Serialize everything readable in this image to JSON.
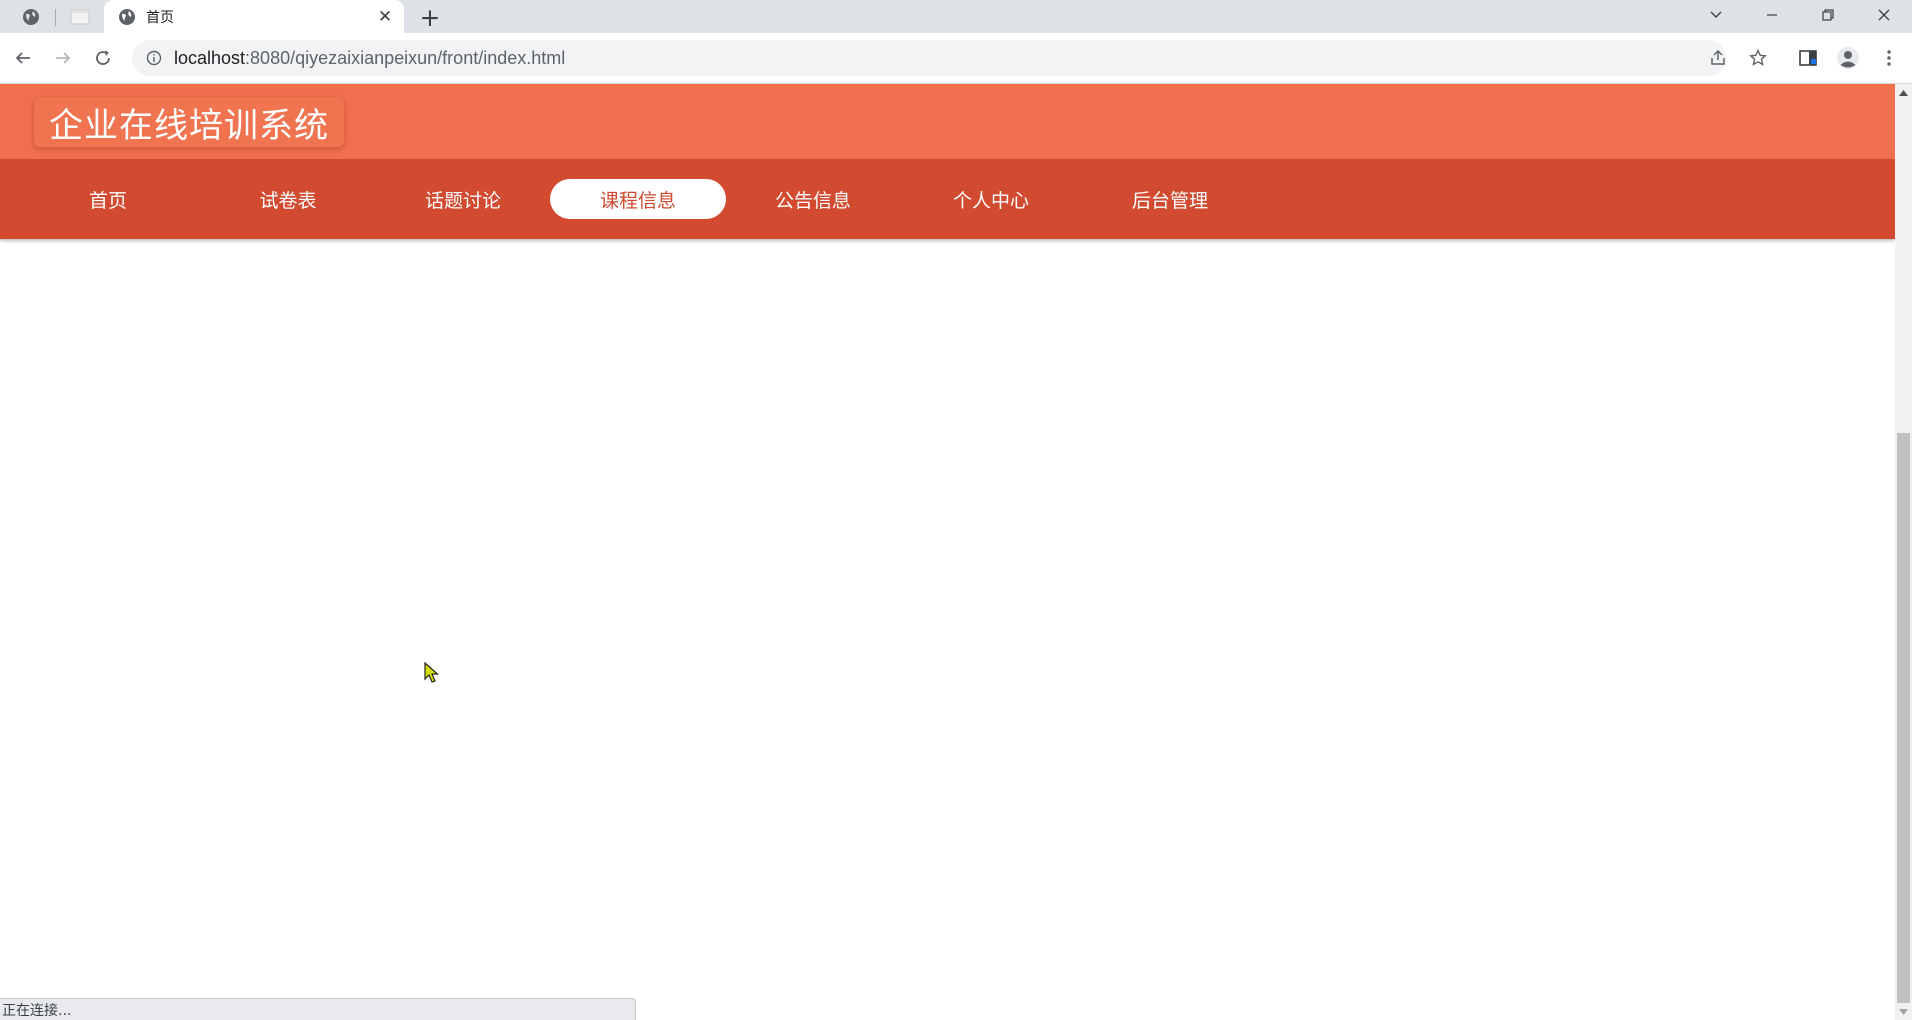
{
  "browser": {
    "tab_title": "首页",
    "tab_close": "✕",
    "new_tab": "+",
    "url_host": "localhost",
    "url_rest": ":8080/qiyezaixianpeixun/front/index.html",
    "status_text": "正在连接..."
  },
  "site": {
    "brand": "企业在线培训系统",
    "nav": [
      {
        "label": "首页",
        "active": false
      },
      {
        "label": "试卷表",
        "active": false
      },
      {
        "label": "话题讨论",
        "active": false
      },
      {
        "label": "课程信息",
        "active": true
      },
      {
        "label": "公告信息",
        "active": false
      },
      {
        "label": "个人中心",
        "active": false
      },
      {
        "label": "后台管理",
        "active": false
      }
    ]
  },
  "colors": {
    "header": "#f06f4f",
    "nav_bar": "#d24a30",
    "nav_active_bg": "#ffffff",
    "nav_active_text": "#d24a30"
  },
  "icons": [
    "globe-icon",
    "blank-page-icon",
    "close-icon",
    "plus-icon",
    "chevron-down-icon",
    "minimize-icon",
    "restore-icon",
    "window-close-icon",
    "back-arrow-icon",
    "forward-arrow-icon",
    "reload-icon",
    "info-icon",
    "share-icon",
    "star-icon",
    "side-panel-icon",
    "profile-icon",
    "kebab-menu-icon",
    "mouse-cursor-icon"
  ]
}
